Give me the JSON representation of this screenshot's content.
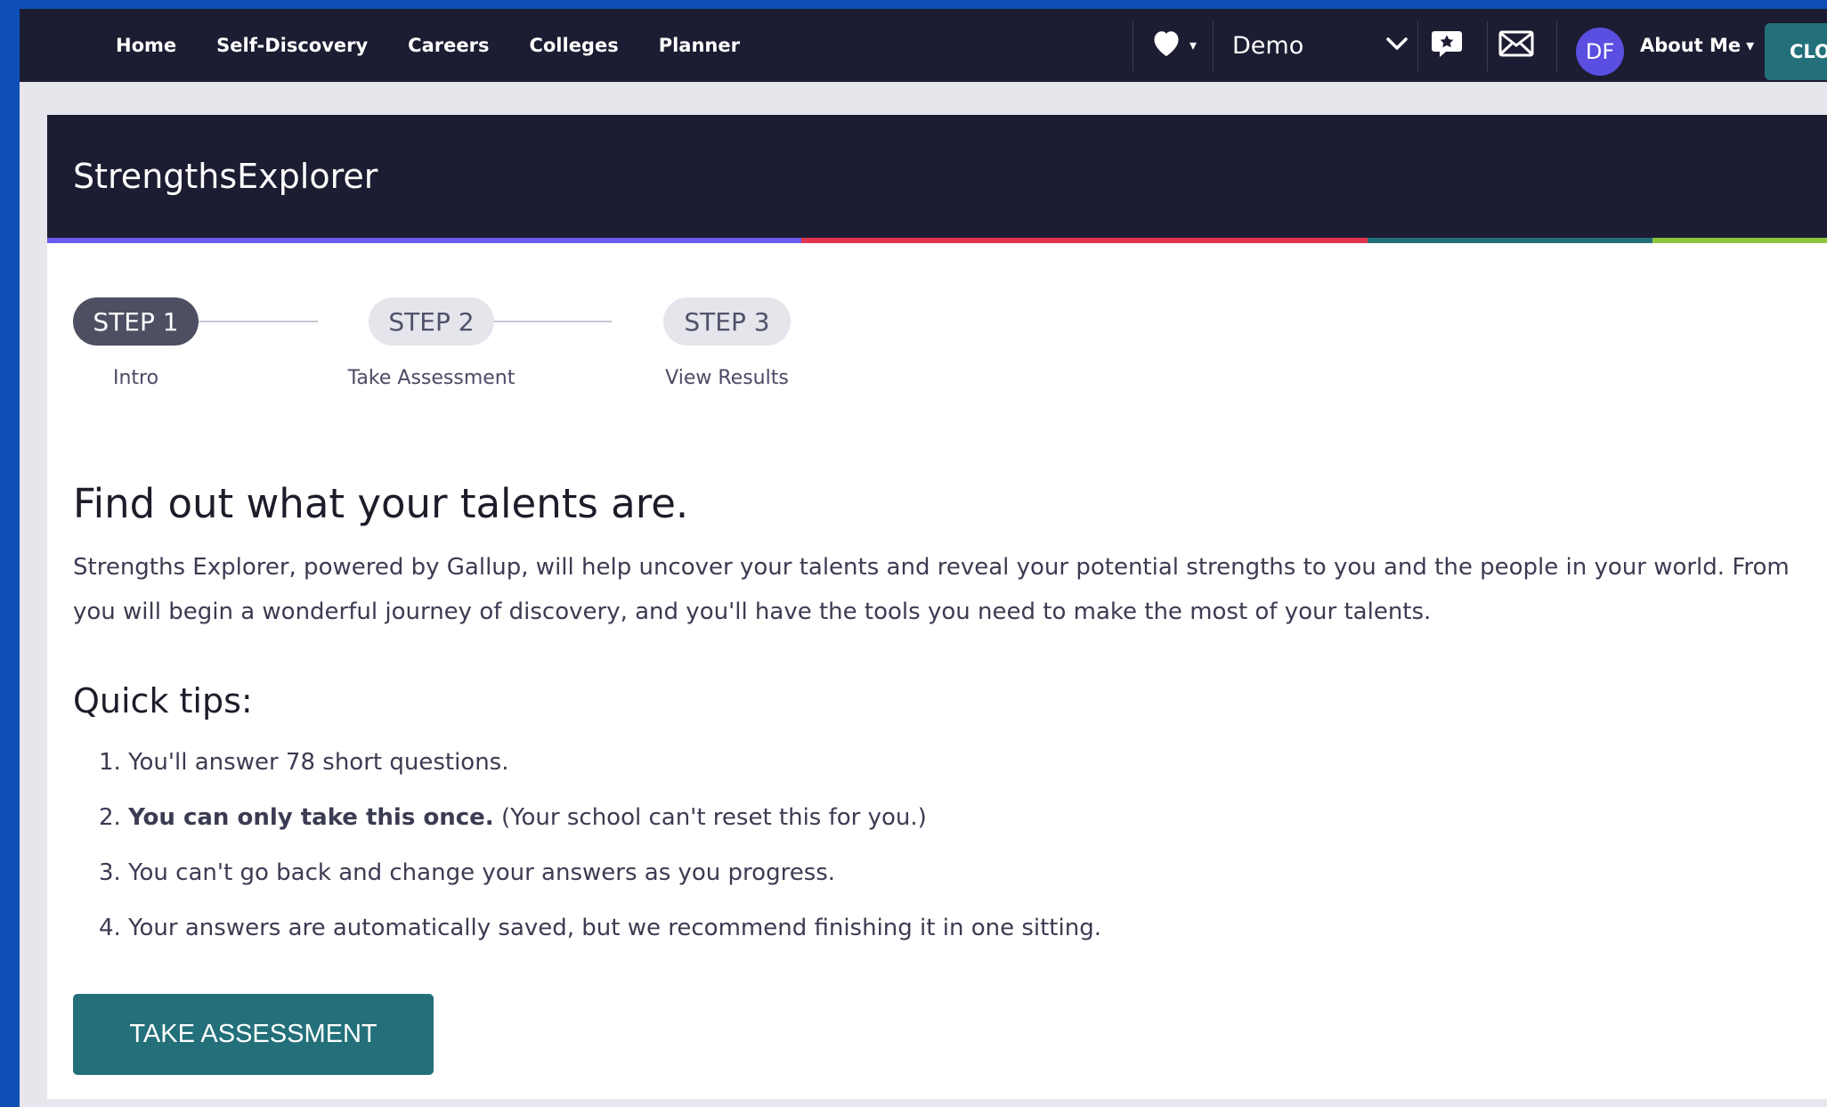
{
  "nav": {
    "links": [
      "Home",
      "Self-Discovery",
      "Careers",
      "Colleges",
      "Planner"
    ],
    "favorites_caret": "▾",
    "profile_select": "Demo",
    "avatar_initials": "DF",
    "about_me": "About Me",
    "about_me_caret": "▾",
    "close_label": "CLOSE"
  },
  "card": {
    "title": "StrengthsExplorer",
    "strip_colors": [
      "#6b5cf0",
      "#e0344f",
      "#23707a",
      "#8cc63f"
    ]
  },
  "stepper": {
    "steps": [
      {
        "pill": "STEP 1",
        "label": "Intro",
        "active": true
      },
      {
        "pill": "STEP 2",
        "label": "Take Assessment",
        "active": false
      },
      {
        "pill": "STEP 3",
        "label": "View Results",
        "active": false
      }
    ]
  },
  "content": {
    "headline": "Find out what your talents are.",
    "intro_line1": "Strengths Explorer, powered by Gallup, will help uncover your talents and reveal your potential strengths to you and the people in your world. From",
    "intro_line2": "you will begin a wonderful journey of discovery, and you'll have the tools you need to make the most of your talents.",
    "tips_title": "Quick tips:",
    "tips": [
      {
        "num": "1.",
        "bold": "",
        "text": "You'll answer 78 short questions."
      },
      {
        "num": "2.",
        "bold": "You can only take this once.",
        "text": "(Your school can't reset this for you.)"
      },
      {
        "num": "3.",
        "bold": "",
        "text": "You can't go back and change your answers as you progress."
      },
      {
        "num": "4.",
        "bold": "",
        "text": "Your answers are automatically saved, but we recommend finishing it in one sitting."
      }
    ],
    "take_button": "TAKE ASSESSMENT"
  },
  "colors": {
    "nav_bg": "#1c1c32",
    "teal": "#23707a",
    "avatar": "#5a4fe0"
  }
}
